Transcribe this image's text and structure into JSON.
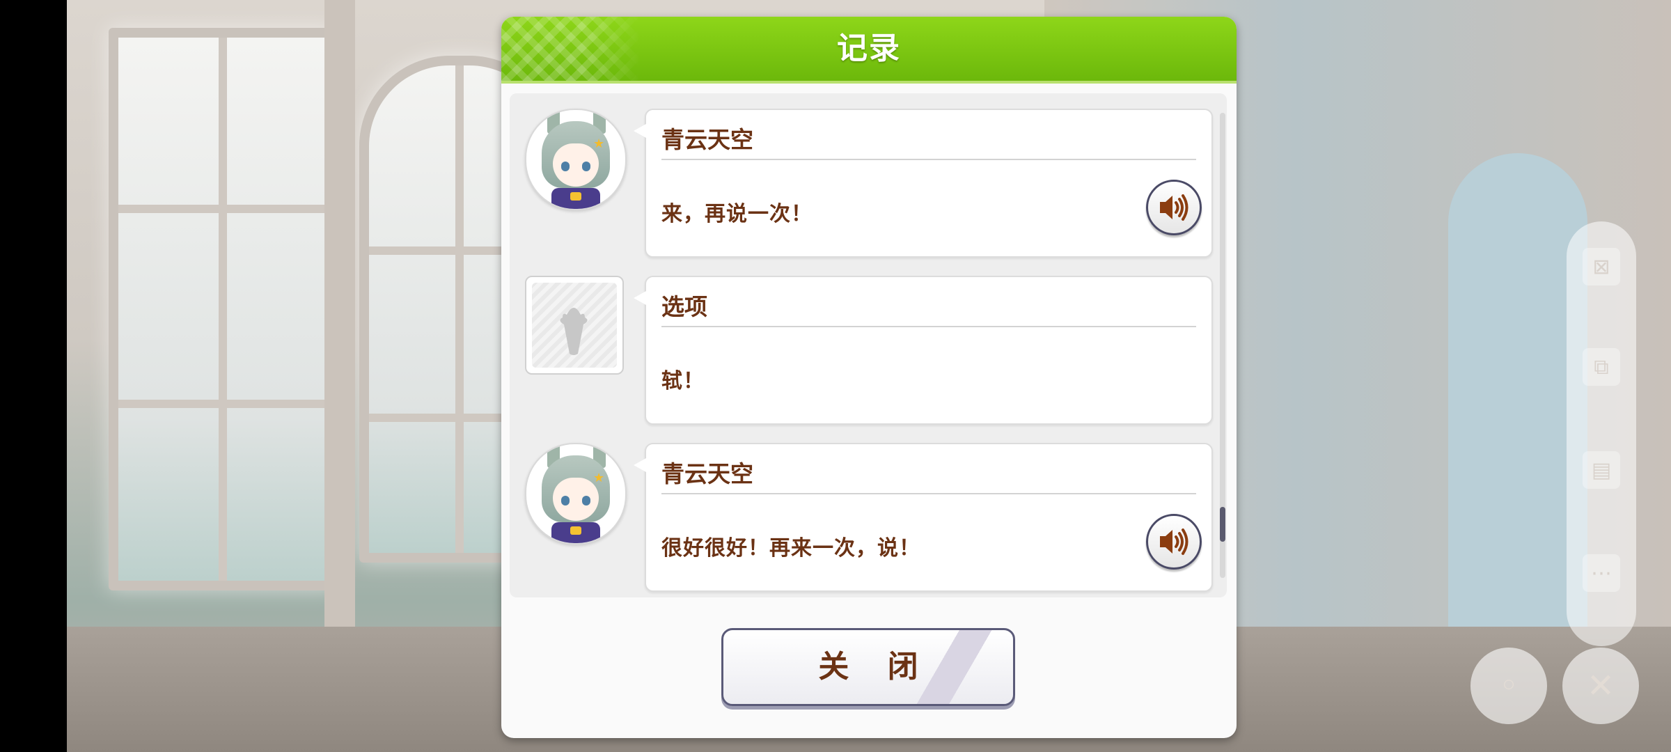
{
  "dialog": {
    "title": "记录",
    "close_label": "关 闭"
  },
  "log": [
    {
      "speaker": "青云天空",
      "text": "来，再说一次！",
      "has_voice": true,
      "avatar": "seiun-sky-avatar"
    },
    {
      "speaker": "选项",
      "text": "轼！",
      "has_voice": false,
      "avatar": "choice-placeholder-icon"
    },
    {
      "speaker": "青云天空",
      "text": "很好很好！再来一次，说！",
      "has_voice": true,
      "avatar": "seiun-sky-avatar"
    }
  ],
  "scroll": {
    "position_fraction": 0.88
  },
  "colors": {
    "header_green": "#7cc60f",
    "text_brown": "#6b3214",
    "button_border": "#5a5a78"
  }
}
